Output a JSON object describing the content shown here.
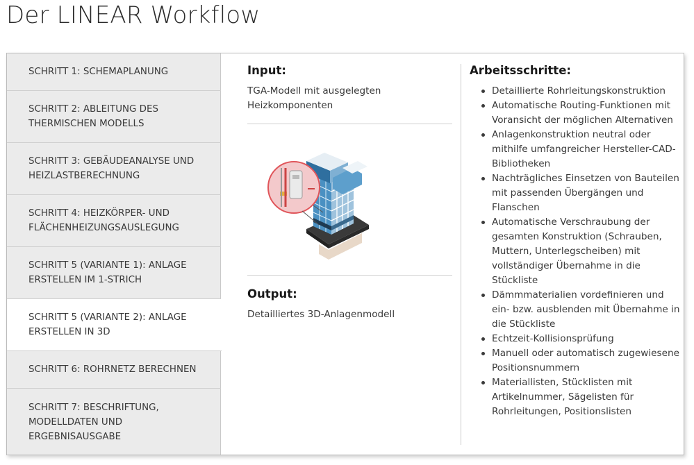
{
  "page": {
    "title": "Der LINEAR Workflow"
  },
  "steps": [
    {
      "label": "Schritt 1: Schemaplanung"
    },
    {
      "label": "Schritt 2: Ableitung des thermischen Modells"
    },
    {
      "label": "Schritt 3: Gebäudeanalyse und Heizlastberechnung"
    },
    {
      "label": "Schritt 4: Heizkörper- und Flächenheizungsauslegung"
    },
    {
      "label": "Schritt 5 (Variante 1): Anlage erstellen im 1-Strich"
    },
    {
      "label": "Schritt 5 (Variante 2): Anlage erstellen in 3D"
    },
    {
      "label": "Schritt 6: Rohrnetz berechnen"
    },
    {
      "label": "Schritt 7: Beschriftung, Modelldaten und Ergebnisausgabe"
    }
  ],
  "active_step_index": 5,
  "content": {
    "input_heading": "Input:",
    "input_text": "TGA-Modell mit ausgelegten Heizkomponenten",
    "output_heading": "Output:",
    "output_text": "Detailliertes 3D-Anlagenmodell",
    "illustration_icon": "isometric-building-3d-model-icon",
    "steps_heading": "Arbeitsschritte:",
    "bullets": [
      "Detaillierte Rohrleitungskonstruktion",
      "Automatische Routing-Funktionen mit Voransicht der möglichen Alternativen",
      "Anlagenkonstruktion neutral oder mithilfe umfangreicher Hersteller-CAD-Bibliotheken",
      "Nachträgliches Einsetzen von Bauteilen mit passenden Übergängen und Flanschen",
      "Automatische Verschraubung der gesamten Konstruktion (Schrauben, Muttern, Unterlegscheiben) mit vollständiger Übernahme in die Stückliste",
      "Dämmmaterialien vordefinieren und ein- bzw. ausblenden mit Übernahme in die Stückliste",
      "Echtzeit-Kollisionsprüfung",
      "Manuell oder automatisch zugewiesene Positionsnummern",
      "Materiallisten, Stücklisten mit Artikelnummer, Sägelisten für Rohrleitungen, Positionslisten"
    ]
  },
  "colors": {
    "sidebar_bg": "#ebebeb",
    "active_bg": "#ffffff",
    "text": "#3a3a3a",
    "heading": "#1a1a1a",
    "accent_red": "#e0555a",
    "building_blue": "#4a90c2"
  }
}
